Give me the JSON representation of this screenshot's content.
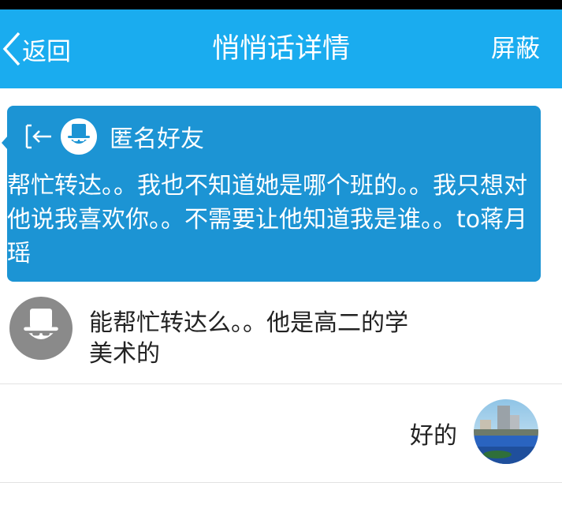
{
  "navbar": {
    "back_label": "返回",
    "title": "悄悄话详情",
    "right_label": "屏蔽"
  },
  "card": {
    "sender_name": "匿名好友",
    "message": "帮忙转达。。我也不知道她是哪个班的。。我只想对他说我喜欢你。。不需要让他知道我是谁。。to蒋月瑶"
  },
  "conversation": [
    {
      "side": "left",
      "text": "能帮忙转达么。。他是高二的学美术的"
    },
    {
      "side": "right",
      "text": "好的"
    }
  ],
  "colors": {
    "navbar": "#1aacef",
    "card": "#1c94d4",
    "text": "#222222"
  }
}
